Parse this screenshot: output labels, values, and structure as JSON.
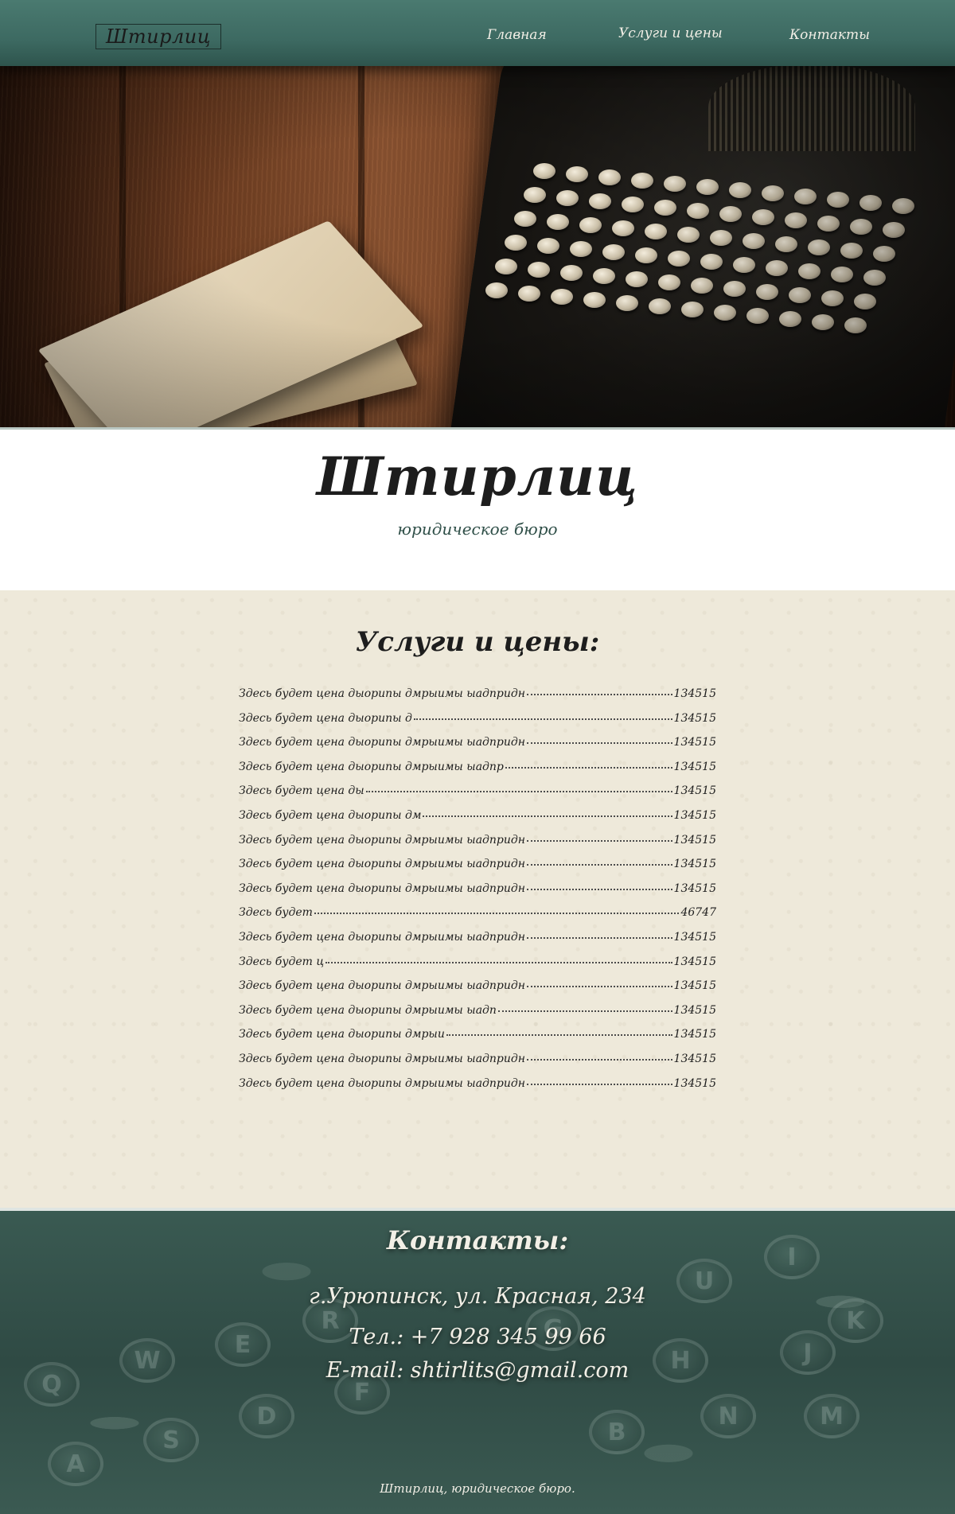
{
  "header": {
    "logo": "Штирлиц",
    "nav": {
      "home": "Главная",
      "services": "Услуги и цены",
      "contacts": "Контакты"
    }
  },
  "hero": {
    "image": "vintage-typewriter-and-books-photo"
  },
  "intro": {
    "title": "Штирлиц",
    "subtitle": "юридическое бюро"
  },
  "services": {
    "title": "Услуги и цены:",
    "items": [
      {
        "name": "Здесь будет цена дыорипы дмрыимы ыадпридн ",
        "price": "134515"
      },
      {
        "name": "Здесь будет цена дыорипы д",
        "price": "134515"
      },
      {
        "name": "Здесь будет цена дыорипы дмрыимы ыадпридн ",
        "price": "134515"
      },
      {
        "name": "Здесь будет цена дыорипы дмрыимы ыадпр",
        "price": "134515"
      },
      {
        "name": "Здесь будет цена ды",
        "price": "134515"
      },
      {
        "name": "Здесь будет цена дыорипы дм",
        "price": "134515"
      },
      {
        "name": "Здесь будет цена дыорипы дмрыимы ыадпридн ",
        "price": "134515"
      },
      {
        "name": "Здесь будет цена дыорипы дмрыимы ыадпридн ",
        "price": "134515"
      },
      {
        "name": "Здесь будет цена дыорипы дмрыимы ыадпридн ",
        "price": "134515"
      },
      {
        "name": "Здесь будет",
        "price": "46747"
      },
      {
        "name": "Здесь будет цена дыорипы дмрыимы ыадпридн ",
        "price": "134515"
      },
      {
        "name": "Здесь будет ц",
        "price": "134515"
      },
      {
        "name": "Здесь будет цена дыорипы дмрыимы ыадпридн ",
        "price": "134515"
      },
      {
        "name": "Здесь будет цена дыорипы дмрыимы ыадп",
        "price": "134515"
      },
      {
        "name": "Здесь будет цена дыорипы дмрыи",
        "price": "134515"
      },
      {
        "name": "Здесь будет цена дыорипы дмрыимы ыадпридн ",
        "price": "134515"
      },
      {
        "name": "Здесь будет цена дыорипы дмрыимы ыадпридн ",
        "price": "134515"
      }
    ]
  },
  "contacts": {
    "title": "Контакты:",
    "address": "г.Урюпинск, ул. Красная, 234",
    "phone": "Тел.: +7 928 345 99 66",
    "email": "E-mail: shtirlits@gmail.com",
    "background": "typewriter-keys-photo"
  },
  "footer": {
    "copyright": "Штирлиц, юридическое бюро."
  },
  "colors": {
    "header_teal": "#3d6a62",
    "paper": "#eee9da",
    "footer_teal": "#2f4a44",
    "text_dark": "#1d1d1d",
    "text_light": "#f2efe6"
  }
}
